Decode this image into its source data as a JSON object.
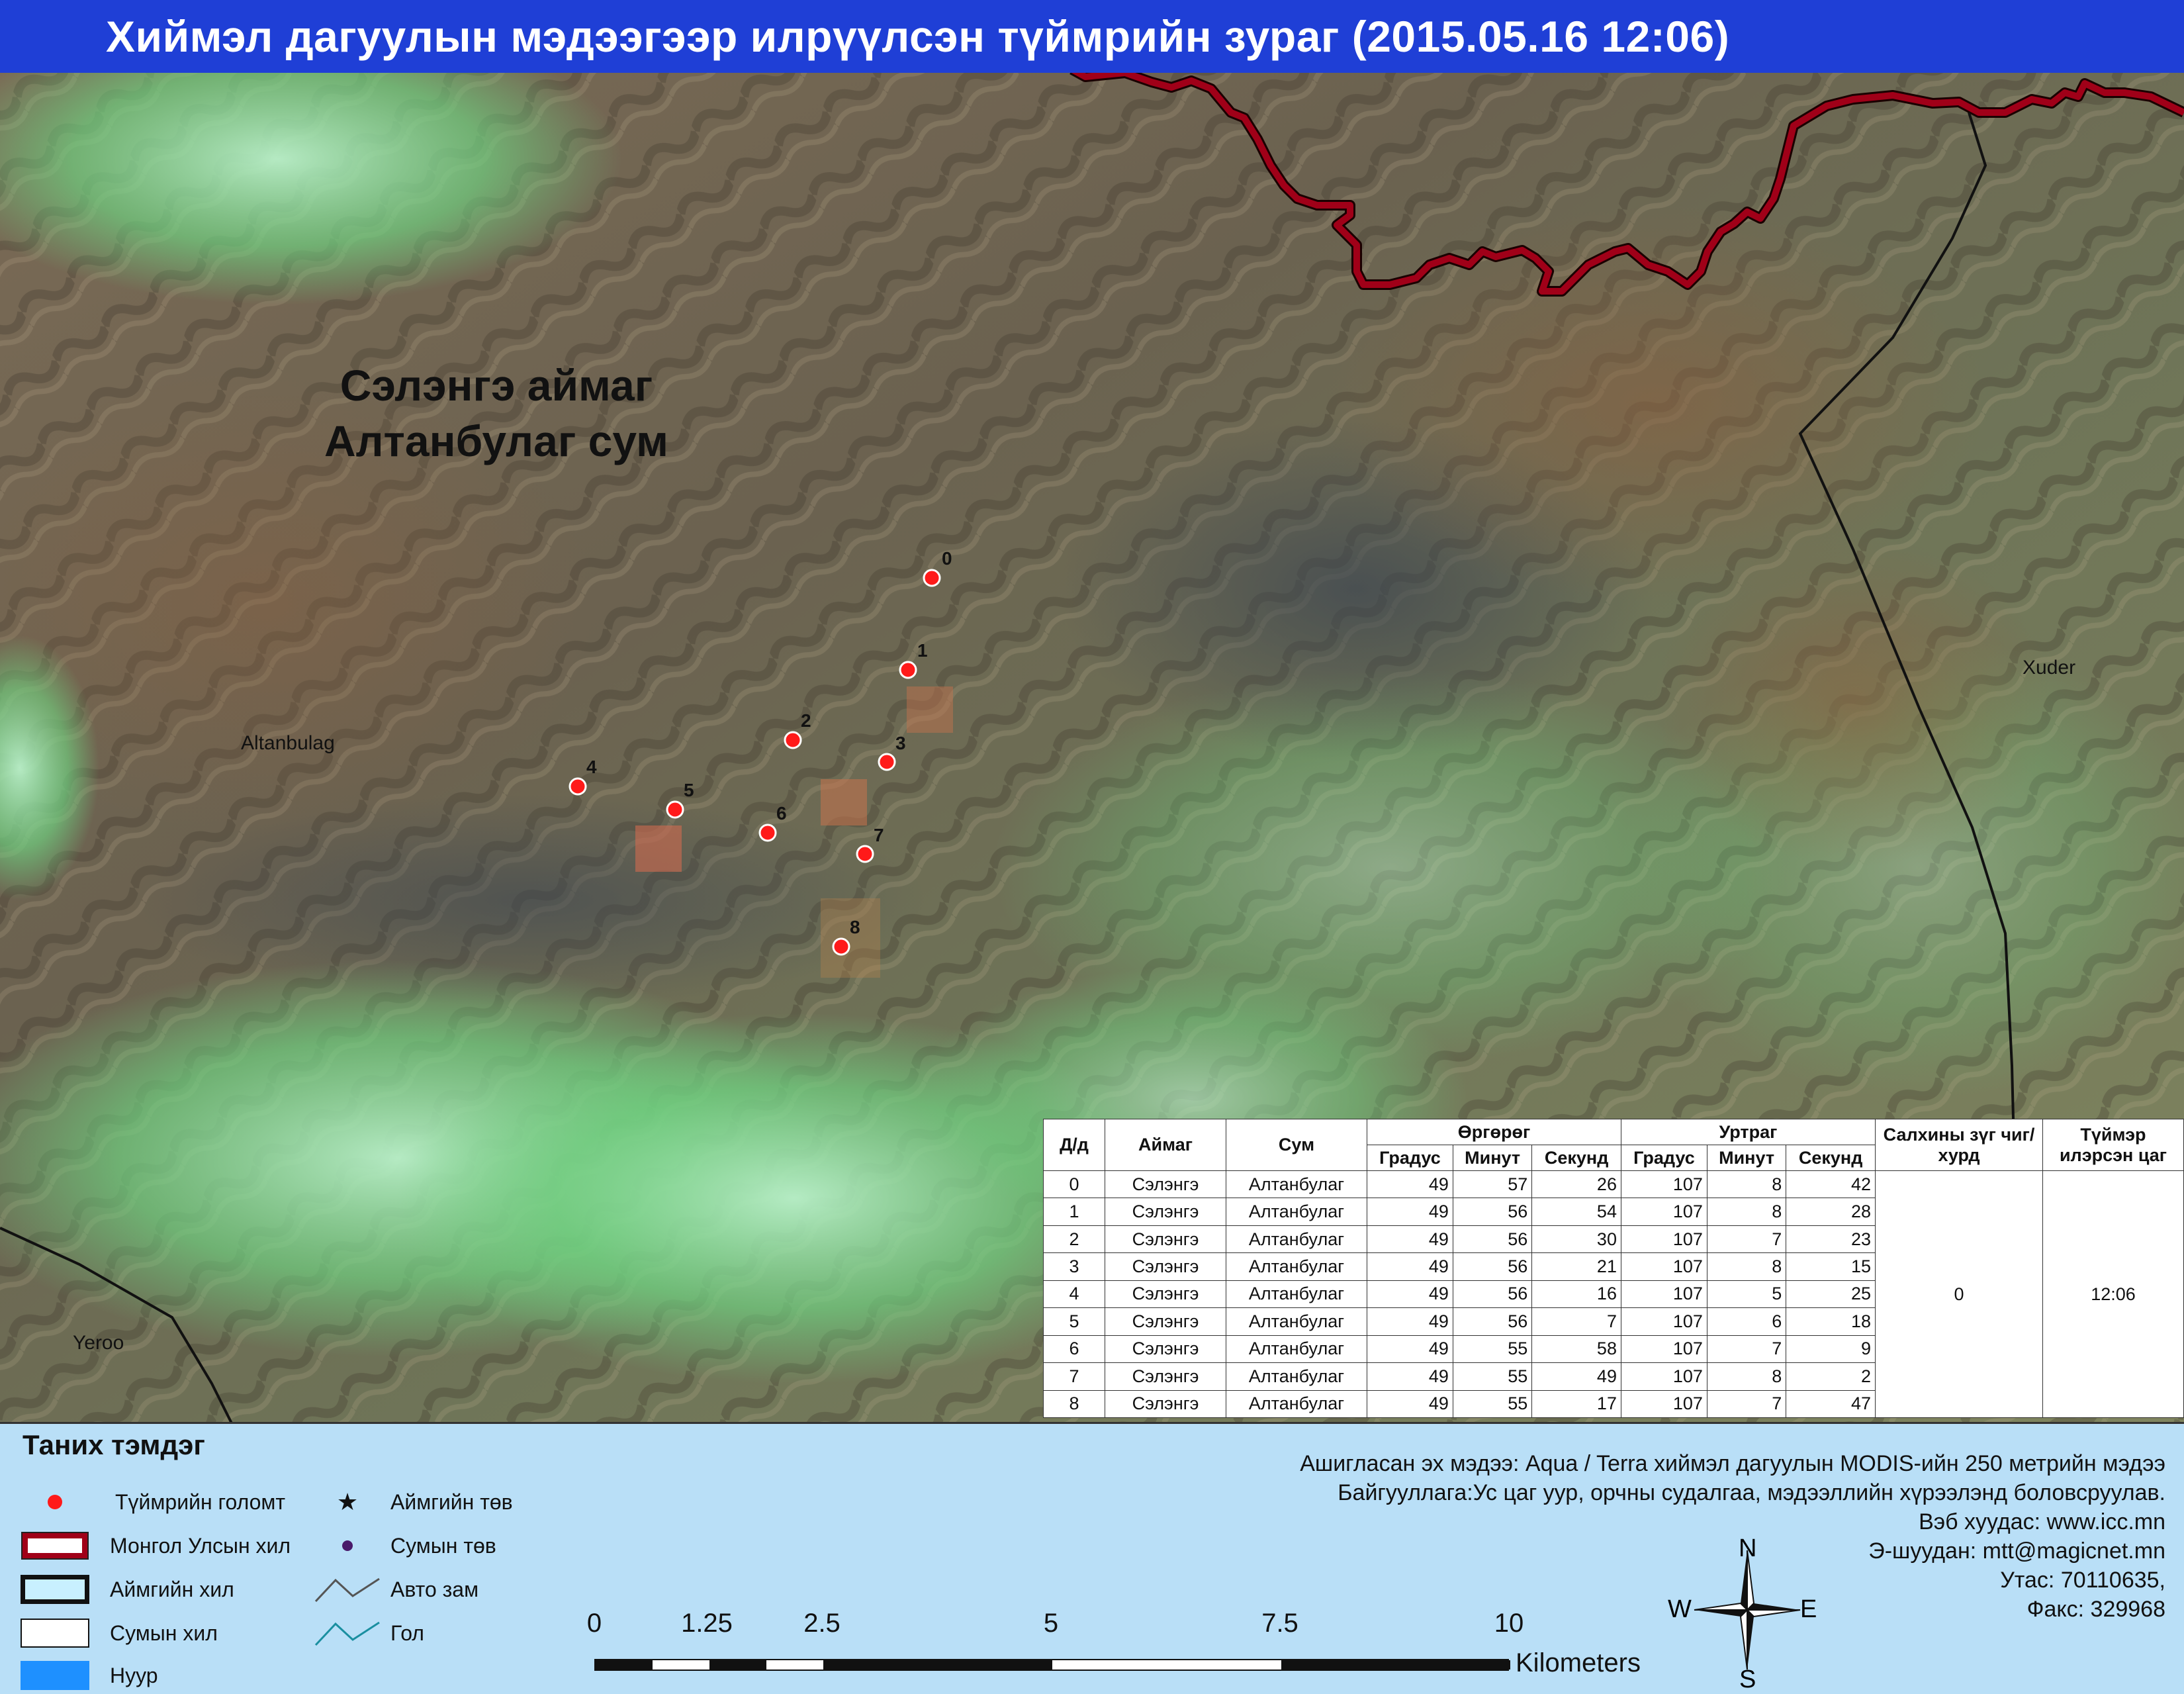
{
  "title": "Хиймэл дагуулын мэдээгээр илрүүлсэн түймрийн зураг  (2015.05.16 12:06)",
  "map": {
    "region_lines": [
      "Сэлэнгэ аймаг",
      "Алтанбулаг сум"
    ],
    "places": [
      {
        "name": "Altanbulag"
      },
      {
        "name": "Xuder"
      },
      {
        "name": "Yeroo"
      }
    ],
    "fire_points": [
      "0",
      "1",
      "2",
      "3",
      "4",
      "5",
      "6",
      "7",
      "8"
    ],
    "colors": {
      "fire": "#ff1a1a",
      "border": "#a00018"
    }
  },
  "table": {
    "headers": {
      "dd": "Д/д",
      "aimag": "Аймаг",
      "sum": "Сум",
      "lat": "Өргөрөг",
      "lon": "Уртраг",
      "deg": "Градус",
      "min": "Минут",
      "sec": "Секунд",
      "wind": "Салхины зүг чиг/хурд",
      "time": "Түймэр илэрсэн цаг"
    },
    "rows": [
      {
        "dd": "0",
        "aimag": "Сэлэнгэ",
        "sum": "Алтанбулаг",
        "lat_deg": "49",
        "lat_min": "57",
        "lat_sec": "26",
        "lon_deg": "107",
        "lon_min": "8",
        "lon_sec": "42"
      },
      {
        "dd": "1",
        "aimag": "Сэлэнгэ",
        "sum": "Алтанбулаг",
        "lat_deg": "49",
        "lat_min": "56",
        "lat_sec": "54",
        "lon_deg": "107",
        "lon_min": "8",
        "lon_sec": "28"
      },
      {
        "dd": "2",
        "aimag": "Сэлэнгэ",
        "sum": "Алтанбулаг",
        "lat_deg": "49",
        "lat_min": "56",
        "lat_sec": "30",
        "lon_deg": "107",
        "lon_min": "7",
        "lon_sec": "23"
      },
      {
        "dd": "3",
        "aimag": "Сэлэнгэ",
        "sum": "Алтанбулаг",
        "lat_deg": "49",
        "lat_min": "56",
        "lat_sec": "21",
        "lon_deg": "107",
        "lon_min": "8",
        "lon_sec": "15"
      },
      {
        "dd": "4",
        "aimag": "Сэлэнгэ",
        "sum": "Алтанбулаг",
        "lat_deg": "49",
        "lat_min": "56",
        "lat_sec": "16",
        "lon_deg": "107",
        "lon_min": "5",
        "lon_sec": "25"
      },
      {
        "dd": "5",
        "aimag": "Сэлэнгэ",
        "sum": "Алтанбулаг",
        "lat_deg": "49",
        "lat_min": "56",
        "lat_sec": "7",
        "lon_deg": "107",
        "lon_min": "6",
        "lon_sec": "18"
      },
      {
        "dd": "6",
        "aimag": "Сэлэнгэ",
        "sum": "Алтанбулаг",
        "lat_deg": "49",
        "lat_min": "55",
        "lat_sec": "58",
        "lon_deg": "107",
        "lon_min": "7",
        "lon_sec": "9"
      },
      {
        "dd": "7",
        "aimag": "Сэлэнгэ",
        "sum": "Алтанбулаг",
        "lat_deg": "49",
        "lat_min": "55",
        "lat_sec": "49",
        "lon_deg": "107",
        "lon_min": "8",
        "lon_sec": "2"
      },
      {
        "dd": "8",
        "aimag": "Сэлэнгэ",
        "sum": "Алтанбулаг",
        "lat_deg": "49",
        "lat_min": "55",
        "lat_sec": "17",
        "lon_deg": "107",
        "lon_min": "7",
        "lon_sec": "47"
      }
    ],
    "wind_value": "0",
    "time_value": "12:06"
  },
  "legend": {
    "title": "Таних тэмдэг",
    "items": {
      "fire": "Түймрийн голомт",
      "country": "Монгол Улсын хил",
      "aimag_border": "Аймгийн хил",
      "sum_border": "Сумын хил",
      "lake": "Нуур",
      "aimag_center": "Аймгийн төв",
      "sum_center": "Сумын төв",
      "road": "Авто зам",
      "river": "Гол"
    }
  },
  "source": {
    "line1": "Ашигласан эх мэдээ: Aqua / Terra хиймэл дагуулын MODIS-ийн 250 метрийн мэдээ",
    "line2": "Байгууллага:Ус цаг уур, орчны судалгаа, мэдээллийн хүрээлэнд боловсруулав.",
    "line3": "Вэб хуудас: www.icc.mn",
    "line4": "Э-шуудан: mtt@magicnet.mn",
    "line5": "Утас: 70110635,",
    "line6": "Факс: 329968"
  },
  "scale": {
    "ticks": [
      "0",
      "1.25",
      "2.5",
      "5",
      "7.5",
      "10"
    ],
    "unit": "Kilometers"
  },
  "compass": {
    "n": "N",
    "s": "S",
    "e": "E",
    "w": "W"
  }
}
